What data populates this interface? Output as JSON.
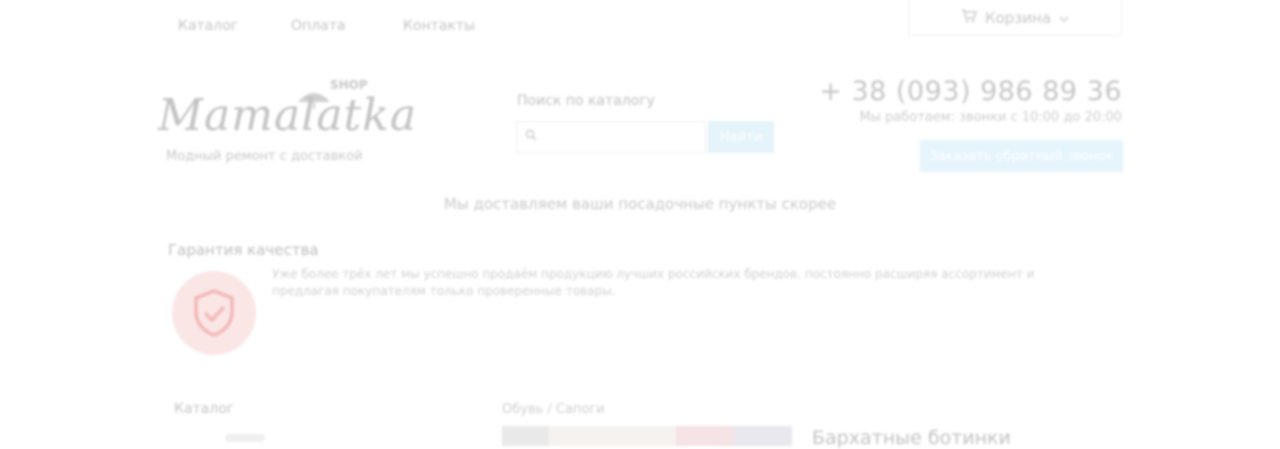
{
  "nav": {
    "items": [
      "Каталог",
      "Оплата",
      "Контакты"
    ]
  },
  "cart": {
    "label": "Корзина",
    "icon": "cart-icon",
    "arrow_icon": "chevron-down-icon"
  },
  "logo": {
    "name": "Mamalatka",
    "badge": "SHOP",
    "tagline": "Модный ремонт с доставкой"
  },
  "search": {
    "label": "Поиск по каталогу",
    "placeholder": "",
    "button_label": "Найти",
    "icon": "search-icon"
  },
  "contact": {
    "phone": "+ 38 (093) 986 89 36",
    "hours": "Мы работаем: звонки с 10:00 до 20:00",
    "callback_label": "Заказать обратный звонок"
  },
  "notice": "Мы доставляем ваши посадочные пункты скорее",
  "guarantee": {
    "title": "Гарантия качества",
    "icon": "shield-check-icon",
    "text": "Уже более трёх лет мы успешно продаём продукцию лучших российских брендов, постоянно расширяя ассортимент и предлагая покупателям только проверенные товары."
  },
  "bottom": {
    "left_heading": "Каталог",
    "breadcrumb": "Обувь / Сапоги",
    "product_title": "Бархатные ботинки"
  },
  "colors": {
    "accent_button": "#e5f3fb",
    "shield_bg": "#fbe6e6",
    "shield_stroke": "#f3bcbc"
  }
}
